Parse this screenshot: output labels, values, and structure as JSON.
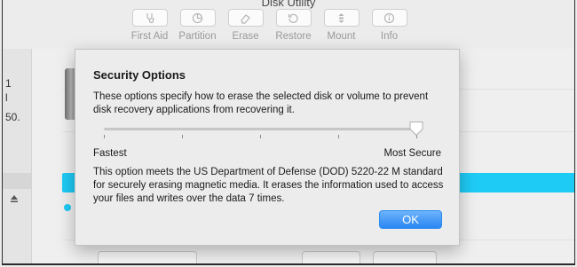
{
  "window": {
    "title": "Disk Utility"
  },
  "toolbar": {
    "items": [
      {
        "label": "First Aid",
        "icon": "stethoscope-icon"
      },
      {
        "label": "Partition",
        "icon": "pie-chart-icon"
      },
      {
        "label": "Erase",
        "icon": "eraser-icon"
      },
      {
        "label": "Restore",
        "icon": "restore-icon"
      },
      {
        "label": "Mount",
        "icon": "mount-icon"
      },
      {
        "label": "Info",
        "icon": "info-icon"
      }
    ]
  },
  "sidebar": {
    "fragments": [
      "1",
      "l",
      "50."
    ]
  },
  "sheet": {
    "title": "Security Options",
    "description": "These options specify how to erase the selected disk or volume to prevent disk recovery applications from recovering it.",
    "slider": {
      "min_label": "Fastest",
      "max_label": "Most Secure",
      "value": 4,
      "max": 4
    },
    "info": "This option meets the US Department of Defense (DOD) 5220-22 M standard for securely erasing magnetic media. It erases the information used to access your files and writes over the data 7 times.",
    "ok_label": "OK"
  },
  "colors": {
    "accent": "#2a86f4",
    "highlight": "#1ecbf5"
  }
}
